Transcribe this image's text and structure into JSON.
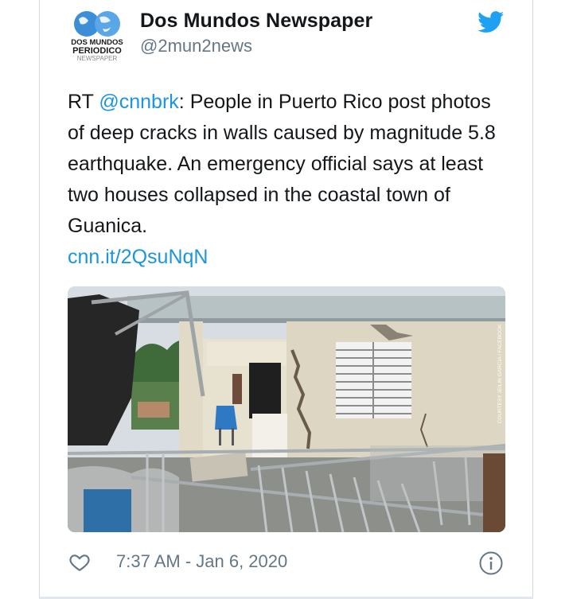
{
  "account": {
    "name": "Dos Mundos Newspaper",
    "handle": "@2mun2news",
    "avatar_text": [
      "DOS MUNDOS",
      "PERIODICO",
      "NEWSPAPER"
    ]
  },
  "tweet": {
    "prefix": "RT ",
    "mention": "@cnnbrk",
    "body": ": People in Puerto Rico post photos of deep cracks in walls caused by magnitude 5.8 earthquake. An emergency official says at least two houses collapsed in the coastal town of Guanica.",
    "link": "cnn.it/2QsuNqN"
  },
  "media": {
    "credit": "COURTESY JEILIN GARCIA / FACEBOOK"
  },
  "footer": {
    "timestamp": "7:37 AM - Jan 6, 2020"
  },
  "colors": {
    "accent": "#1b95e0",
    "twitter_blue": "#1da1f2",
    "secondary_text": "#657786",
    "border": "#cfd9de"
  },
  "icons": {
    "brand": "twitter-bird-icon",
    "like": "heart-icon",
    "info": "info-icon"
  }
}
